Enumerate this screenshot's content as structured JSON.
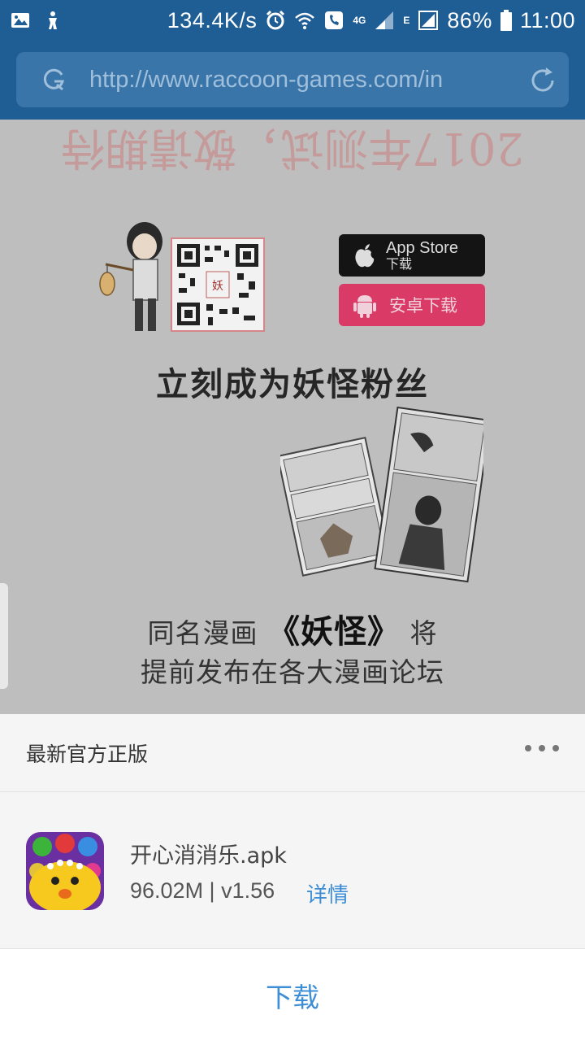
{
  "status_bar": {
    "speed": "134.4K/s",
    "network": "4G",
    "edge": "E",
    "battery": "86%",
    "time": "11:00"
  },
  "browser": {
    "url": "http://www.raccoon-games.com/in"
  },
  "page": {
    "banner": "2017年测试，敬请期待",
    "appstore_main": "App Store",
    "appstore_sub": "下载",
    "android_label": "安卓下载",
    "headline": "立刻成为妖怪粉丝",
    "promo_line1_a": "同名漫画",
    "promo_line1_title": "《妖怪》",
    "promo_line1_b": "将",
    "promo_line2": "提前发布在各大漫画论坛"
  },
  "sheet": {
    "title": "最新官方正版",
    "file_name": "开心消消乐.apk",
    "file_meta": "96.02M | v1.56",
    "details_label": "详情",
    "download_label": "下载"
  },
  "colors": {
    "header_blue": "#1f5d95",
    "link_blue": "#3d8ed6",
    "android_pink": "#d93a66"
  }
}
